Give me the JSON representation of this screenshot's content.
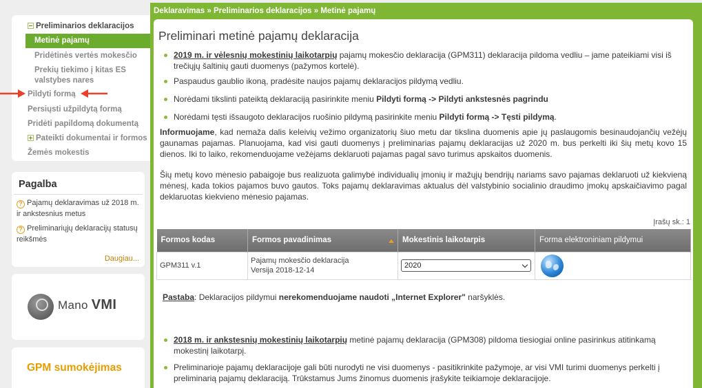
{
  "sidebar": {
    "nav": {
      "group1": "Preliminarios deklaracijos",
      "active": "Metinė pajamų",
      "item_pvm": "Pridėtinės vertės mokesčio",
      "item_es": "Prekių tiekimo į kitas ES valstybes nares",
      "fill_form": "Pildyti formą",
      "send_filled": "Persiųsti užpildytą formą",
      "add_doc": "Pridėti papildomą dokumentą",
      "group2": "Pateikti dokumentai ir formos",
      "land_tax": "Žemės mokestis"
    },
    "help": {
      "title": "Pagalba",
      "item1": "Pajamų deklaravimas už 2018 m. ir ankstesnius metus",
      "item2": "Preliminariųjų deklaracijų statusų reikšmės",
      "more": "Daugiau..."
    },
    "vmi": {
      "prefix": "Mano",
      "suffix": "VMI"
    },
    "gpm": "GPM sumokėjimas"
  },
  "breadcrumb": {
    "item1": "Deklaravimas",
    "item2": "Preliminarios deklaracijos",
    "item3": "Metinė pajamų",
    "sep": "»"
  },
  "main": {
    "title": "Preliminari metinė pajamų deklaracija",
    "b1_link": "2019 m. ir vėlesnių mokestinių laikotarpių",
    "b1_text": " pajamų mokesčio deklaracija (GPM311) deklaracija pildoma vedliu – jame pateikiami visi iš trečiųjų šaltinių gauti duomenys (pažymos kortelė).",
    "b2_text": "Paspaudus gaublio ikoną, pradėsite naujos pajamų deklaracijos pildymą vedliu.",
    "b3_text": "Norėdami tikslinti pateiktą deklaraciją pasirinkite meniu ",
    "b3_bold": "Pildyti formą -> Pildyti ankstesnės pagrindu",
    "b4_text": "Norėdami tęsti išsaugoto deklaracijos ruošinio pildymą pasirinkite meniu ",
    "b4_bold": "Pildyti formą -> Tęsti pildymą",
    "info_bold": "Informuojame",
    "info_text": ", kad nemaža dalis keleivių vežimo organizatorių šiuo metu dar tikslina duomenis apie jų paslaugomis besinaudojančių vežėjų gaunamas pajamas. Planuojama, kad visi gauti duomenys į preliminarias pajamų deklaracijas už 2020 m. bus perkelti iki šių metų kovo 15 dienos. Iki to laiko, rekomenduojame vežėjams deklaruoti pajamas pagal savo turimus apskaitos duomenis.",
    "para2": "Šių metų kovo mėnesio pabaigoje bus realizuota galimybė individualių įmonių ir mažųjų bendrijų nariams savo pajamas deklaruoti už kiekvieną mėnesį, kada tokios pajamos buvo gautos. Toks pajamų deklaravimas aktualus dėl valstybinio socialinio draudimo įmokų apskaičiavimo pagal deklaruotas kiekvieno mėnesio pajamas.",
    "records_count": "Įrašų sk.: 1",
    "table": {
      "headers": [
        "Formos kodas",
        "Formos pavadinimas",
        "Mokestinis laikotarpis",
        "Forma elektroniniam pildymui"
      ],
      "row": {
        "code": "GPM311 v.1",
        "name_line1": "Pajamų mokesčio deklaracija",
        "name_line2": "Versija 2018-12-14",
        "period": "2020"
      }
    },
    "note_label": "Pastaba",
    "note_text": ": Deklaracijos pildymui ",
    "note_bold": "nerekomenduojame naudoti „Internet Explorer\"",
    "note_end": " naršyklės.",
    "b5_link": "2018 m. ir ankstesnių mokestinių laikotarpių",
    "b5_text": " metinė pajamų deklaracija (GPM308) pildoma tiesiogiai online pasirinkus atitinkamą mokestinį laikotarpį.",
    "b6_text": "Preliminarioje pajamų deklaracijoje gali būti nurodyti ne visi duomenys - pasitikrinkite pažymoje, ar visi VMI turimi duomenys perkelti į preliminarią pajamų deklaraciją. Trūkstamus Jums žinomus duomenis įrašykite teikiamoje deklaracijoje."
  },
  "colors": {
    "green": "#7fb734",
    "active": "#6bab2e",
    "orange": "#e69d00",
    "arrow": "#e8402a"
  }
}
